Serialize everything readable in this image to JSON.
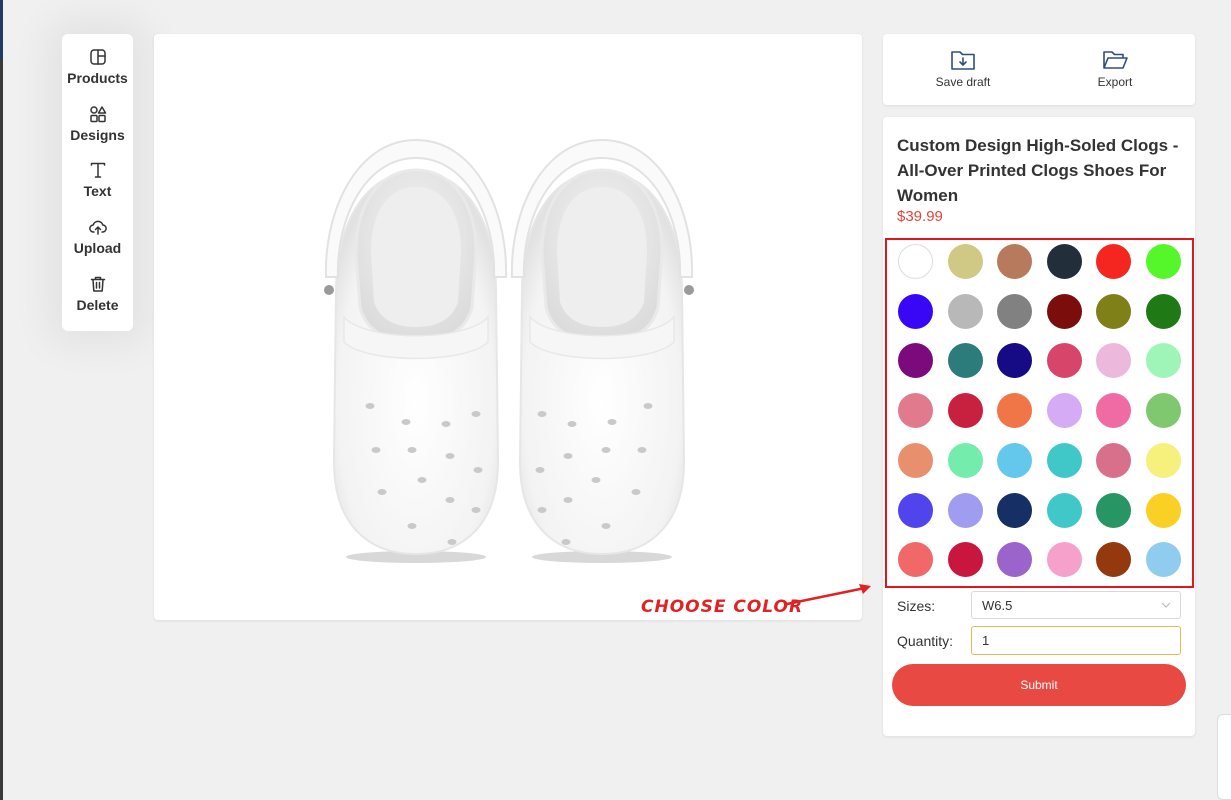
{
  "sidebar": {
    "items": [
      {
        "label": "Products",
        "icon": "products-icon"
      },
      {
        "label": "Designs",
        "icon": "designs-icon"
      },
      {
        "label": "Text",
        "icon": "text-icon"
      },
      {
        "label": "Upload",
        "icon": "upload-icon"
      },
      {
        "label": "Delete",
        "icon": "trash-icon"
      }
    ]
  },
  "actions": {
    "save_label": "Save draft",
    "export_label": "Export"
  },
  "product": {
    "title": "Custom Design High-Soled Clogs - All-Over Printed Clogs Shoes For Women",
    "price": "$39.99"
  },
  "colors": [
    "#ffffff",
    "#cfc985",
    "#b87a5c",
    "#222e3a",
    "#f5261f",
    "#55f72a",
    "#3a06f6",
    "#b8b8b8",
    "#818181",
    "#7b0d0d",
    "#808018",
    "#1f7a16",
    "#7c0a7c",
    "#2c7c7c",
    "#170a85",
    "#d8456a",
    "#ecb8dc",
    "#9ff5b8",
    "#e07a8c",
    "#c8203f",
    "#f07648",
    "#d4abf4",
    "#f06ba4",
    "#80c870",
    "#e8906e",
    "#73ecac",
    "#64c8ec",
    "#40c8c8",
    "#d8708c",
    "#f6f07c",
    "#5044ec",
    "#a09cf0",
    "#163066",
    "#40c8c8",
    "#289664",
    "#fad024",
    "#f06868",
    "#c8163e",
    "#9a64cc",
    "#f6a0cc",
    "#94380e",
    "#90cced"
  ],
  "annotation": "CHOOSE COLOR",
  "sizes": {
    "label": "Sizes:",
    "value": "W6.5"
  },
  "quantity": {
    "label": "Quantity:",
    "value": "1"
  },
  "submit_label": "Submit"
}
